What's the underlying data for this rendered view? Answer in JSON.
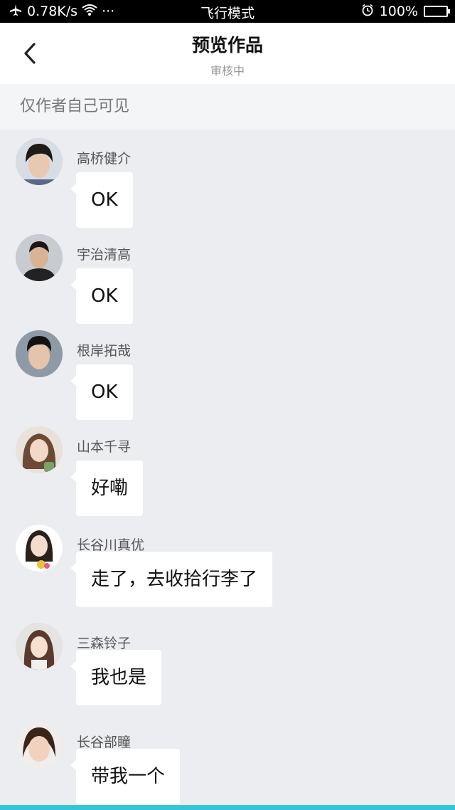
{
  "status_bar": {
    "speed": "0.78K/s",
    "more": "···",
    "mode": "飞行模式",
    "battery": "100%"
  },
  "header": {
    "title": "预览作品",
    "subtitle": "审核中"
  },
  "notice": "仅作者自己可见",
  "messages": [
    {
      "name": "高桥健介",
      "text": "OK"
    },
    {
      "name": "宇治清高",
      "text": "OK"
    },
    {
      "name": "根岸拓哉",
      "text": "OK"
    },
    {
      "name": "山本千寻",
      "text": "好嘞"
    },
    {
      "name": "长谷川真优",
      "text": "走了，去收拾行李了"
    },
    {
      "name": "三森铃子",
      "text": "我也是"
    },
    {
      "name": "长谷部瞳",
      "text": "带我一个"
    }
  ],
  "colors": {
    "background": "#ebedf1",
    "accent": "#36c5d8"
  }
}
